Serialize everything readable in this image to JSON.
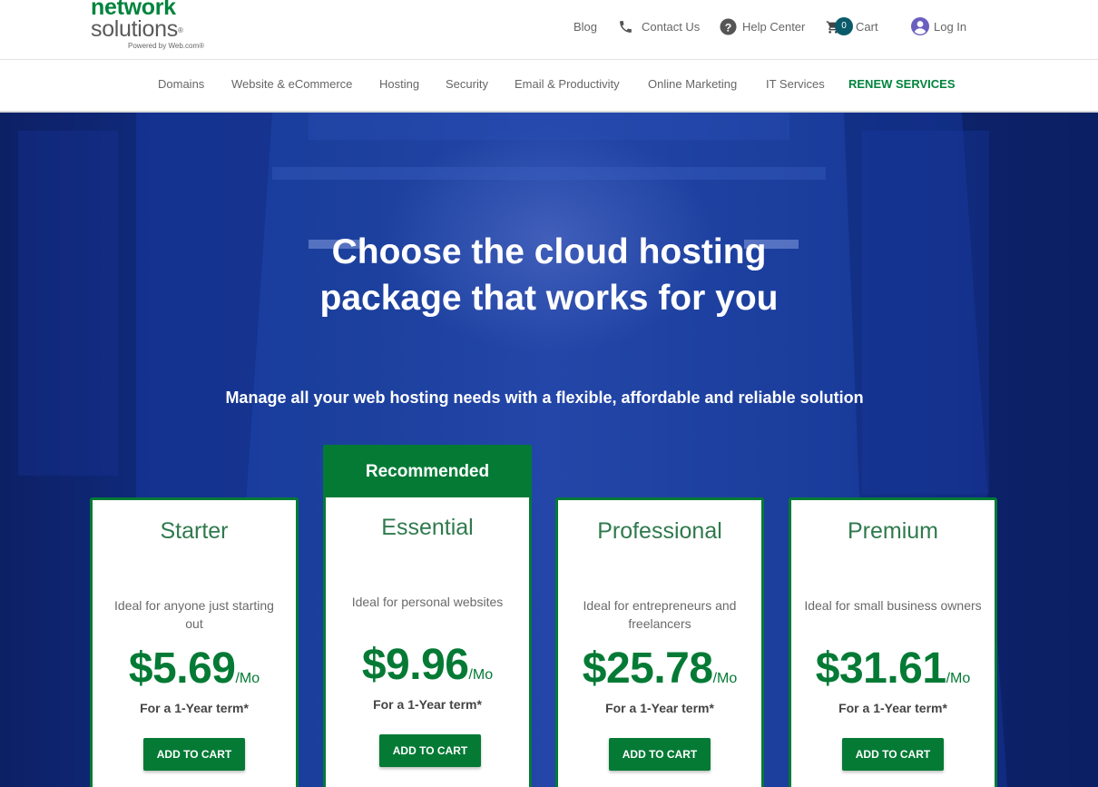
{
  "header": {
    "logo": {
      "line1": "network",
      "line2": "solutions",
      "trademark": "®",
      "tagline": "Powered by Web.com®"
    },
    "utility": {
      "blog": "Blog",
      "contact": "Contact Us",
      "help": "Help Center",
      "cart_label": "Cart",
      "cart_count": "0",
      "login": "Log In"
    },
    "icons": {
      "contact": "phone-icon",
      "help": "question-circle-icon",
      "cart": "cart-icon",
      "login": "user-circle-icon"
    }
  },
  "nav": {
    "items": [
      {
        "label": "Domains"
      },
      {
        "label": "Website & eCommerce"
      },
      {
        "label": "Hosting"
      },
      {
        "label": "Security"
      },
      {
        "label": "Email & Productivity"
      },
      {
        "label": "Online Marketing"
      },
      {
        "label": "IT Services"
      },
      {
        "label": "RENEW SERVICES"
      }
    ]
  },
  "hero": {
    "title_line1": "Choose the cloud hosting",
    "title_line2": "package that works for you",
    "subtitle": "Manage all your web hosting needs with a flexible, affordable and reliable solution"
  },
  "plans": {
    "recommended_label": "Recommended",
    "items": [
      {
        "name": "Starter",
        "desc": "Ideal for anyone just starting out",
        "price": "$5.69",
        "per": "/Mo",
        "term": "For a 1-Year term*",
        "cta": "ADD TO CART"
      },
      {
        "name": "Essential",
        "desc": "Ideal for personal websites",
        "price": "$9.96",
        "per": "/Mo",
        "term": "For a 1-Year term*",
        "cta": "ADD TO CART"
      },
      {
        "name": "Professional",
        "desc": "Ideal for entrepreneurs and freelancers",
        "price": "$25.78",
        "per": "/Mo",
        "term": "For a 1-Year term*",
        "cta": "ADD TO CART"
      },
      {
        "name": "Premium",
        "desc": "Ideal for small business owners",
        "price": "$31.61",
        "per": "/Mo",
        "term": "For a 1-Year term*",
        "cta": "ADD TO CART"
      }
    ]
  },
  "colors": {
    "brand_green": "#047a35",
    "hero_blue": "#1b3f9c",
    "cart_badge": "#0a5b6a",
    "login_icon": "#6a5fbf"
  }
}
